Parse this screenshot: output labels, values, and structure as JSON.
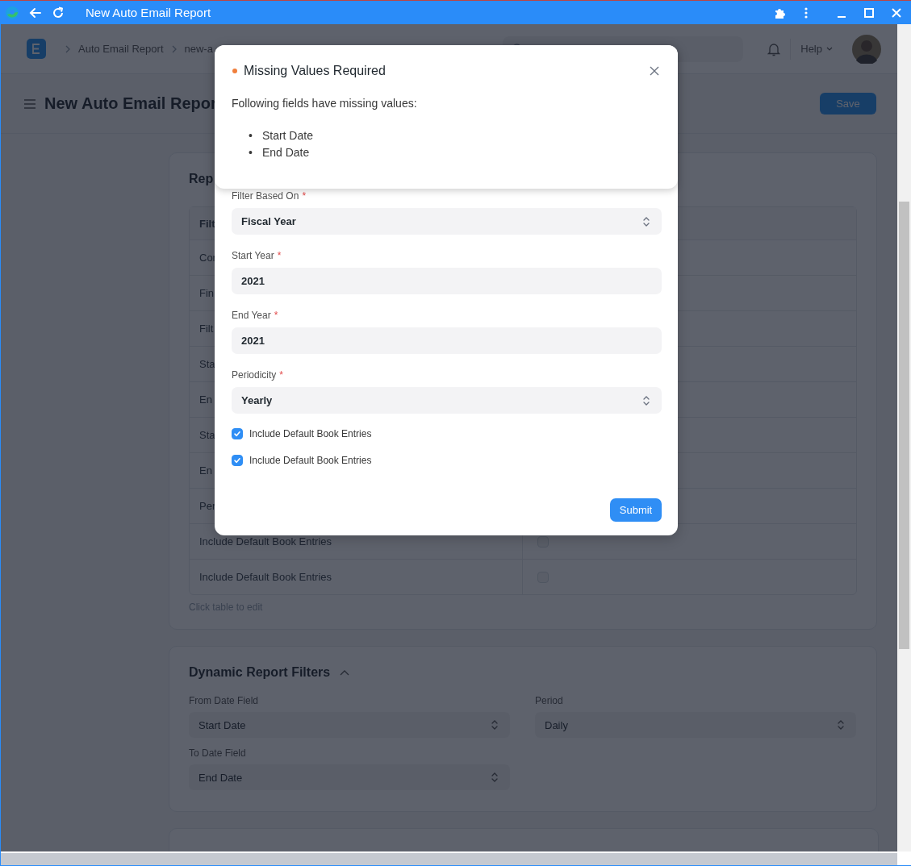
{
  "window": {
    "title": "New Auto Email Report"
  },
  "navbar": {
    "breadcrumbs": [
      "Auto Email Report",
      "new-a"
    ],
    "help": "Help"
  },
  "page": {
    "title": "New Auto Email Repor",
    "save": "Save"
  },
  "report_filters": {
    "title": "Rep",
    "rows": [
      {
        "kind": "header",
        "label": "Filt"
      },
      {
        "kind": "text",
        "label": "Cor"
      },
      {
        "kind": "text",
        "label": "Fin"
      },
      {
        "kind": "text",
        "label": "Filt"
      },
      {
        "kind": "text",
        "label": "Sta"
      },
      {
        "kind": "text",
        "label": "En"
      },
      {
        "kind": "text",
        "label": "Sta"
      },
      {
        "kind": "text",
        "label": "En"
      },
      {
        "kind": "text",
        "label": "Per"
      },
      {
        "kind": "check",
        "label": "Include Default Book Entries",
        "checked": false
      },
      {
        "kind": "check",
        "label": "Include Default Book Entries",
        "checked": false
      }
    ],
    "hint": "Click table to edit"
  },
  "dynamic_filters": {
    "title": "Dynamic Report Filters",
    "expanded": true,
    "fields": [
      {
        "label": "From Date Field",
        "value": "Start Date"
      },
      {
        "label": "Period",
        "value": "Daily"
      },
      {
        "label": "To Date Field",
        "value": "End Date"
      }
    ]
  },
  "dialog": {
    "fields": [
      {
        "kind": "select",
        "label": "Filter Based On",
        "required_mark": "*",
        "value": "Fiscal Year"
      },
      {
        "kind": "input",
        "label": "Start Year",
        "required_mark": "*",
        "value": "2021"
      },
      {
        "kind": "input",
        "label": "End Year",
        "required_mark": "*",
        "value": "2021"
      },
      {
        "kind": "select",
        "label": "Periodicity",
        "required_mark": "*",
        "value": "Yearly"
      },
      {
        "kind": "check",
        "label": "Include Default Book Entries",
        "checked": true
      },
      {
        "kind": "check",
        "label": "Include Default Book Entries",
        "checked": true
      }
    ],
    "submit": "Submit"
  },
  "message": {
    "title": "Missing Values Required",
    "text": "Following fields have missing values:",
    "items": [
      {
        "bullet": "•",
        "text": "Start Date"
      },
      {
        "bullet": "•",
        "text": "End Date"
      }
    ]
  }
}
